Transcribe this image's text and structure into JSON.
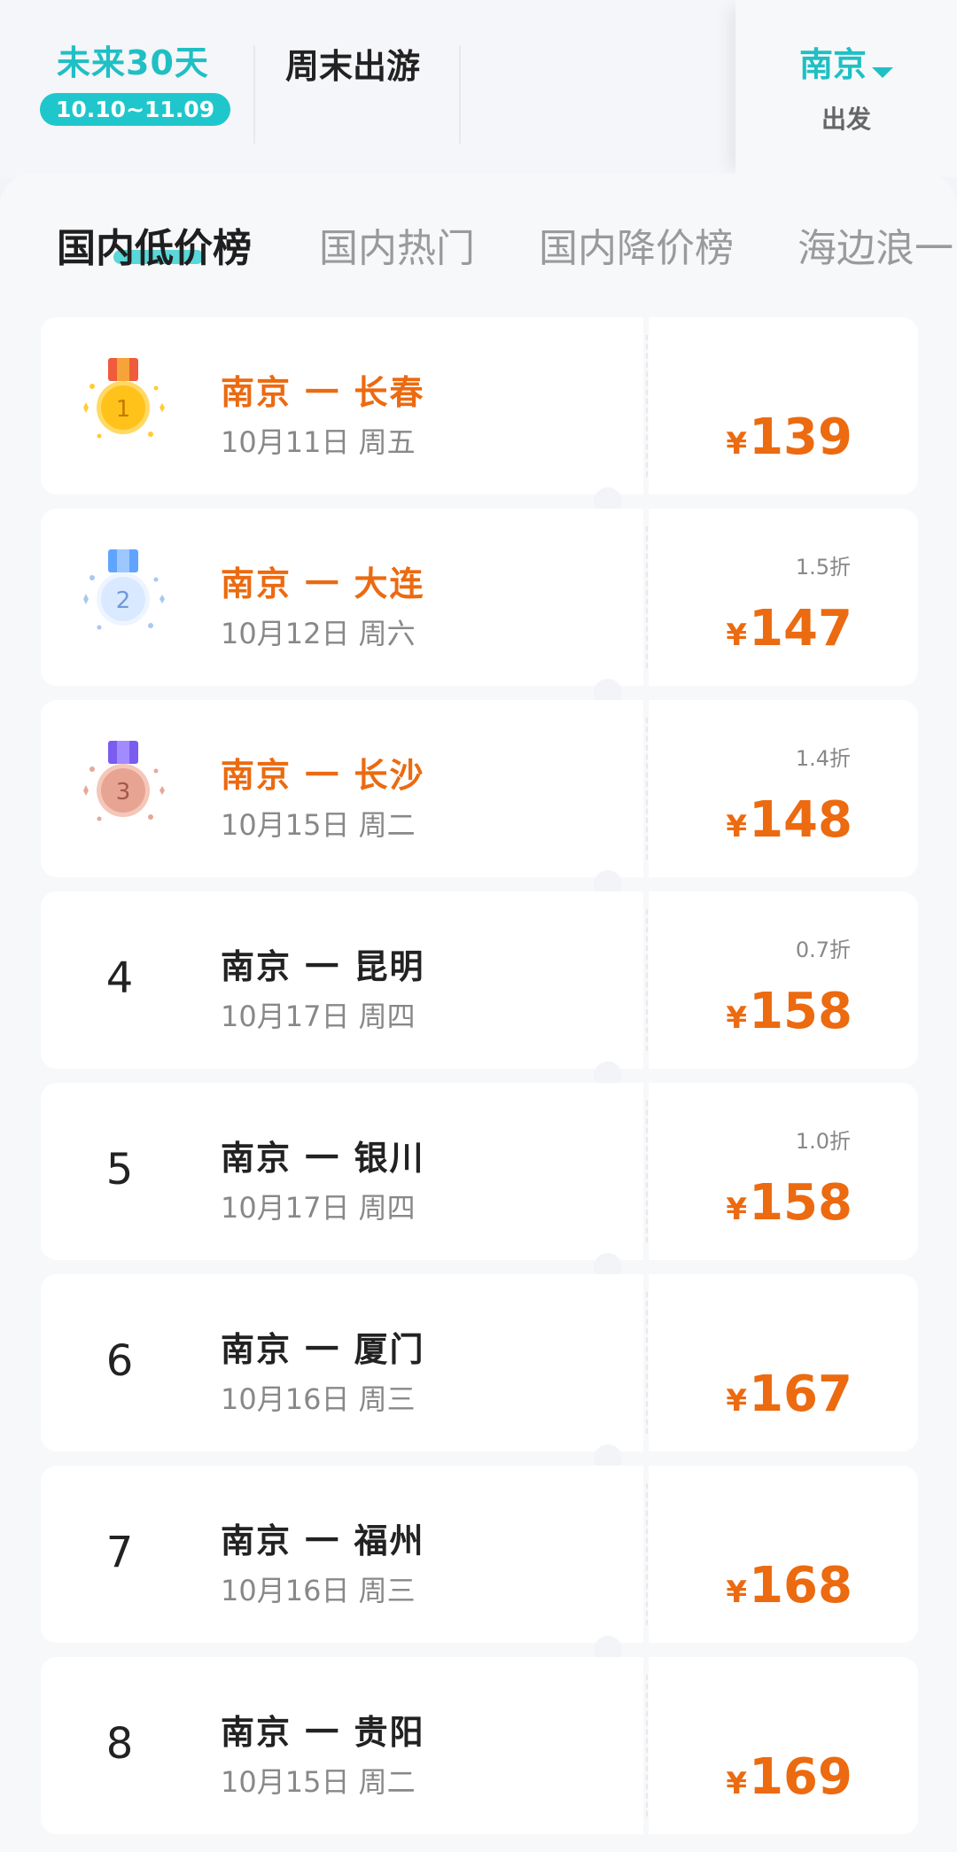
{
  "header": {
    "range_title": "未来30天",
    "range_dates": "10.10~11.09",
    "weekend_label": "周末出游",
    "departure_city": "南京",
    "departure_label": "出发"
  },
  "tabs": [
    {
      "label": "国内低价榜",
      "active": true
    },
    {
      "label": "国内热门",
      "active": false
    },
    {
      "label": "国内降价榜",
      "active": false
    },
    {
      "label": "海边浪一",
      "active": false
    }
  ],
  "colors": {
    "accent": "#1fbfc4",
    "price": "#ec6a10"
  },
  "currency": "¥",
  "rows": [
    {
      "rank": "1",
      "route": "南京 一 长春",
      "date": "10月11日  周五",
      "discount": "",
      "price": "139",
      "medal": "gold"
    },
    {
      "rank": "2",
      "route": "南京 一 大连",
      "date": "10月12日  周六",
      "discount": "1.5折",
      "price": "147",
      "medal": "silver"
    },
    {
      "rank": "3",
      "route": "南京 一 长沙",
      "date": "10月15日  周二",
      "discount": "1.4折",
      "price": "148",
      "medal": "bronze"
    },
    {
      "rank": "4",
      "route": "南京 一 昆明",
      "date": "10月17日  周四",
      "discount": "0.7折",
      "price": "158",
      "medal": ""
    },
    {
      "rank": "5",
      "route": "南京 一 银川",
      "date": "10月17日  周四",
      "discount": "1.0折",
      "price": "158",
      "medal": ""
    },
    {
      "rank": "6",
      "route": "南京 一 厦门",
      "date": "10月16日  周三",
      "discount": "",
      "price": "167",
      "medal": ""
    },
    {
      "rank": "7",
      "route": "南京 一 福州",
      "date": "10月16日  周三",
      "discount": "",
      "price": "168",
      "medal": ""
    },
    {
      "rank": "8",
      "route": "南京 一 贵阳",
      "date": "10月15日  周二",
      "discount": "",
      "price": "169",
      "medal": ""
    }
  ]
}
